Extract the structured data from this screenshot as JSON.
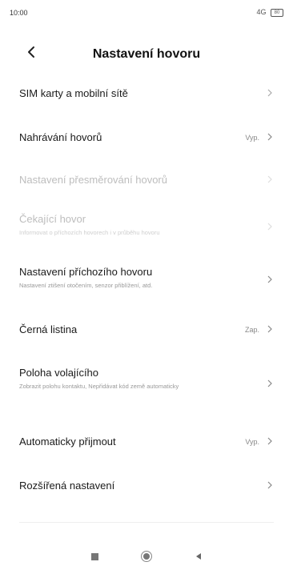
{
  "status_bar": {
    "time": "10:00",
    "signal": "4G",
    "battery": "80"
  },
  "header": {
    "title": "Nastavení hovoru"
  },
  "settings": [
    {
      "title": "SIM karty a mobilní sítě",
      "subtitle": "",
      "value": "",
      "enabled": true
    },
    {
      "title": "Nahrávání hovorů",
      "subtitle": "",
      "value": "Vyp.",
      "enabled": true
    },
    {
      "title": "Nastavení přesměrování hovorů",
      "subtitle": "",
      "value": "",
      "enabled": false
    },
    {
      "title": "Čekající hovor",
      "subtitle": "Informovat o příchozích hovorech i v průběhu hovoru",
      "value": "",
      "enabled": false
    },
    {
      "title": "Nastavení příchozího hovoru",
      "subtitle": "Nastavení ztišení otočením, senzor přiblížení, atd.",
      "value": "",
      "enabled": true
    },
    {
      "title": "Černá listina",
      "subtitle": "",
      "value": "Zap.",
      "enabled": true
    },
    {
      "title": "Poloha volajícího",
      "subtitle": "Zobrazit polohu kontaktu, Nepřidávat kód země automaticky",
      "value": "",
      "enabled": true
    },
    {
      "title": "Automaticky přijmout",
      "subtitle": "",
      "value": "Vyp.",
      "enabled": true
    },
    {
      "title": "Rozšířená nastavení",
      "subtitle": "",
      "value": "",
      "enabled": true
    }
  ],
  "nav_bar": {
    "icons": [
      "square-icon",
      "circle-home-icon",
      "triangle-back-icon"
    ]
  }
}
